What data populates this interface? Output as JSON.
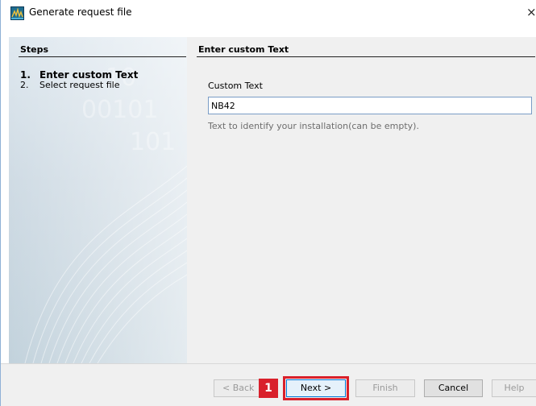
{
  "window": {
    "title": "Generate request file",
    "close_glyph": "×",
    "app_icon": "app-icon"
  },
  "steps": {
    "heading": "Steps",
    "items": [
      {
        "number": "1.",
        "label": "Enter custom Text",
        "current": true
      },
      {
        "number": "2.",
        "label": "Select request file",
        "current": false
      }
    ]
  },
  "content": {
    "heading": "Enter custom Text",
    "field_label": "Custom Text",
    "field_value": "NB42",
    "hint": "Text to identify your installation(can be empty)."
  },
  "buttons": {
    "back": "< Back",
    "next": "Next >",
    "finish": "Finish",
    "cancel": "Cancel",
    "help": "Help"
  },
  "annotation": {
    "marker": "1",
    "color": "#d9202b"
  }
}
